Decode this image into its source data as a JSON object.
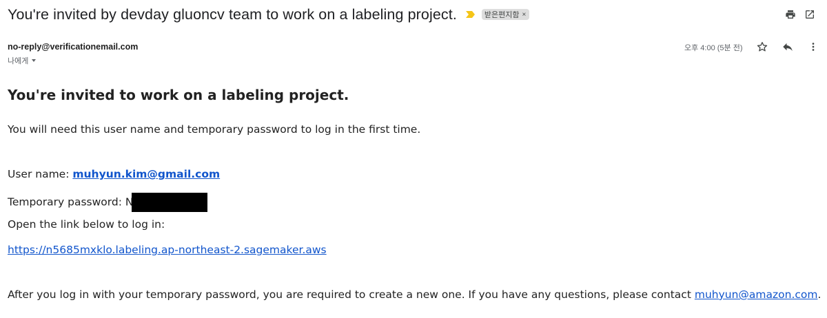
{
  "email": {
    "subject": "You're invited by devday gluoncv team to work on a labeling project.",
    "label_chip": "받은편지함",
    "label_remove": "×",
    "sender_email": "no-reply@verificationemail.com",
    "recipient": "나에게",
    "timestamp": "오후 4:00 (5분 전)"
  },
  "icons": {
    "important": "important-marker-icon",
    "print": "print-icon",
    "open_new_window": "open-in-new-window-icon",
    "star": "star-icon",
    "reply": "reply-icon",
    "more": "more-vert-icon",
    "accent_yellow": "#f5c518",
    "icon_color": "#444746"
  },
  "body": {
    "heading": "You're invited to work on a labeling project.",
    "intro": "You will need this user name and temporary password to log in the first time.",
    "username_label": "User name: ",
    "username_value": "muhyun.kim@gmail.com",
    "password_label": "Temporary password: ",
    "password_visible_char": "N",
    "open_link_text": "Open the link below to log in:",
    "login_link": "https://n5685mxklo.labeling.ap-northeast-2.sagemaker.aws",
    "after_text": "After you log in with your temporary password, you are required to create a new one. If you have any questions, please contact ",
    "contact_email": "muhyun@amazon.com",
    "after_period": "."
  },
  "colors": {
    "link": "#1155cc",
    "text": "#222222",
    "muted": "#5f6368"
  }
}
